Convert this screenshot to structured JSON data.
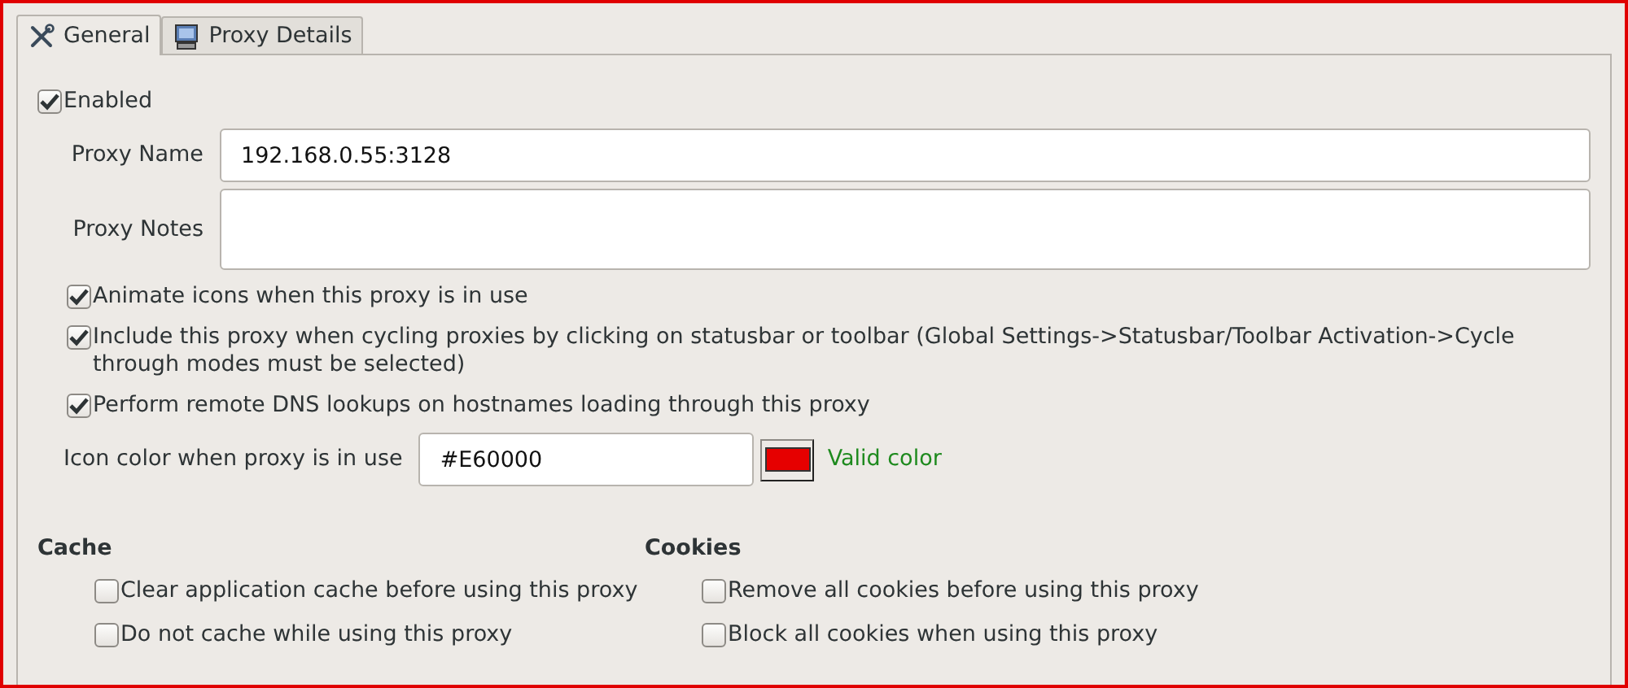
{
  "tabs": [
    {
      "label": "General",
      "selected": true,
      "kind": "tools"
    },
    {
      "label": "Proxy Details",
      "selected": false,
      "kind": "computer"
    }
  ],
  "enabled": {
    "label": "Enabled",
    "checked": true
  },
  "fields": [
    {
      "label": "Proxy Name",
      "value": "192.168.0.55:3128",
      "kind": "line"
    },
    {
      "label": "Proxy Notes",
      "kind": "area"
    }
  ],
  "options": [
    {
      "label": "Animate icons when this proxy is in use",
      "checked": true
    },
    {
      "label": "Include this proxy when cycling proxies by clicking on statusbar or toolbar (Global Settings->Statusbar/Toolbar Activation->Cycle through modes must be selected)",
      "checked": true
    },
    {
      "label": "Perform remote DNS lookups on hostnames loading through this proxy",
      "checked": true
    }
  ],
  "icon_color": {
    "label": "Icon color when proxy is in use",
    "value": "#E60000",
    "color": "#e60000",
    "status": "Valid color"
  },
  "groups": [
    {
      "title": "Cache",
      "options": [
        {
          "label": "Clear application cache before using this proxy",
          "checked": false
        },
        {
          "label": "Do not cache while using this proxy",
          "checked": false
        }
      ]
    },
    {
      "title": "Cookies",
      "options": [
        {
          "label": "Remove all cookies before using this proxy",
          "checked": false
        },
        {
          "label": "Block all cookies when using this proxy",
          "checked": false
        }
      ]
    }
  ]
}
